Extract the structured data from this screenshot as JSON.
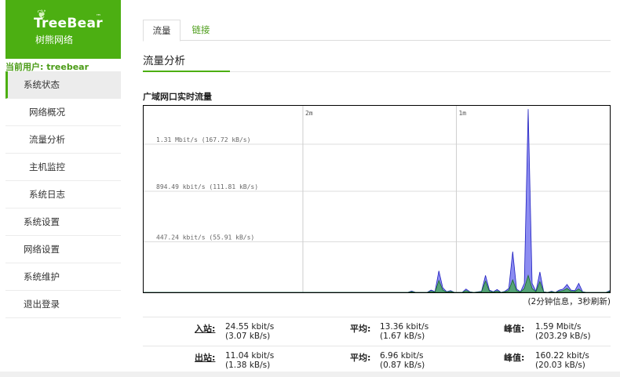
{
  "brand": {
    "name": "TreeBear",
    "tm": "™",
    "subtitle": "树熊网络"
  },
  "user": {
    "current_label": "当前用户: treebear"
  },
  "menu": [
    {
      "label": "系统状态",
      "level": 0,
      "active": true
    },
    {
      "label": "网络概况",
      "level": 1
    },
    {
      "label": "流量分析",
      "level": 1
    },
    {
      "label": "主机监控",
      "level": 1
    },
    {
      "label": "系统日志",
      "level": 1
    },
    {
      "label": "系统设置",
      "level": 0
    },
    {
      "label": "网络设置",
      "level": 0
    },
    {
      "label": "系统维护",
      "level": 0
    },
    {
      "label": "退出登录",
      "level": 0
    }
  ],
  "tabs": [
    {
      "label": "流量",
      "active": true
    },
    {
      "label": "链接",
      "active": false
    }
  ],
  "section": {
    "title": "流量分析"
  },
  "chart_title": "广域网口实时流量",
  "chart_note": "(2分钟信息，3秒刷新)",
  "colors": {
    "brand_green": "#4caf12",
    "inbound_fill": "#8080f0",
    "inbound_stroke": "#2020c0",
    "outbound_fill": "#4fa56a",
    "outbound_stroke": "#1a6b2a"
  },
  "chart_data": {
    "type": "area",
    "x_ticks": [
      "2m",
      "1m"
    ],
    "y_ticks": [
      "447.24 kbit/s (55.91 kB/s)",
      "894.49 kbit/s (111.81 kB/s)",
      "1.31 Mbit/s (167.72 kB/s)"
    ],
    "y_tick_values": [
      447.24,
      894.49,
      1310
    ],
    "ylim": [
      0,
      1650
    ],
    "y_unit": "kbit/s",
    "xlim": [
      -120,
      0
    ],
    "series": [
      {
        "points": [
          [
            -120,
            0
          ],
          [
            -52,
            0
          ],
          [
            -51,
            12
          ],
          [
            -50,
            0
          ],
          [
            -47,
            0
          ],
          [
            -46,
            20
          ],
          [
            -45,
            6
          ],
          [
            -44,
            190
          ],
          [
            -43,
            40
          ],
          [
            -42,
            6
          ],
          [
            -41,
            15
          ],
          [
            -40,
            0
          ],
          [
            -38,
            0
          ],
          [
            -37,
            30
          ],
          [
            -36,
            5
          ],
          [
            -35,
            0
          ],
          [
            -33,
            10
          ],
          [
            -32,
            150
          ],
          [
            -31,
            20
          ],
          [
            -30,
            5
          ],
          [
            -29,
            25
          ],
          [
            -28,
            0
          ],
          [
            -27,
            10
          ],
          [
            -26,
            35
          ],
          [
            -25,
            360
          ],
          [
            -24,
            30
          ],
          [
            -23,
            5
          ],
          [
            -22,
            80
          ],
          [
            -21,
            1620
          ],
          [
            -20,
            80
          ],
          [
            -19,
            10
          ],
          [
            -18,
            180
          ],
          [
            -17,
            5
          ],
          [
            -16,
            0
          ],
          [
            -15,
            10
          ],
          [
            -14,
            0
          ],
          [
            -13,
            20
          ],
          [
            -12,
            30
          ],
          [
            -11,
            70
          ],
          [
            -10,
            20
          ],
          [
            -9,
            15
          ],
          [
            -8,
            80
          ],
          [
            -7,
            5
          ],
          [
            -6,
            0
          ],
          [
            -1,
            0
          ],
          [
            0,
            15
          ]
        ]
      },
      {
        "points": [
          [
            -120,
            0
          ],
          [
            -52,
            0
          ],
          [
            -51,
            6
          ],
          [
            -50,
            0
          ],
          [
            -47,
            0
          ],
          [
            -46,
            10
          ],
          [
            -45,
            3
          ],
          [
            -44,
            105
          ],
          [
            -43,
            20
          ],
          [
            -42,
            3
          ],
          [
            -41,
            8
          ],
          [
            -40,
            0
          ],
          [
            -38,
            0
          ],
          [
            -37,
            15
          ],
          [
            -36,
            3
          ],
          [
            -35,
            0
          ],
          [
            -33,
            5
          ],
          [
            -32,
            100
          ],
          [
            -31,
            10
          ],
          [
            -30,
            3
          ],
          [
            -29,
            12
          ],
          [
            -28,
            0
          ],
          [
            -27,
            5
          ],
          [
            -26,
            15
          ],
          [
            -25,
            110
          ],
          [
            -24,
            15
          ],
          [
            -23,
            3
          ],
          [
            -22,
            35
          ],
          [
            -21,
            150
          ],
          [
            -20,
            35
          ],
          [
            -19,
            5
          ],
          [
            -18,
            95
          ],
          [
            -17,
            3
          ],
          [
            -16,
            0
          ],
          [
            -15,
            5
          ],
          [
            -14,
            0
          ],
          [
            -13,
            10
          ],
          [
            -12,
            15
          ],
          [
            -11,
            35
          ],
          [
            -10,
            10
          ],
          [
            -9,
            8
          ],
          [
            -8,
            30
          ],
          [
            -7,
            3
          ],
          [
            -6,
            0
          ],
          [
            -1,
            0
          ],
          [
            0,
            8
          ]
        ]
      }
    ]
  },
  "stats": {
    "in": {
      "label": "入站:",
      "current": "24.55 kbit/s",
      "current_b": "(3.07 kB/s)",
      "avg_label": "平均:",
      "avg": "13.36 kbit/s",
      "avg_b": "(1.67 kB/s)",
      "peak_label": "峰值:",
      "peak": "1.59 Mbit/s",
      "peak_b": "(203.29 kB/s)"
    },
    "out": {
      "label": "出站:",
      "current": "11.04 kbit/s",
      "current_b": "(1.38 kB/s)",
      "avg_label": "平均:",
      "avg": "6.96 kbit/s",
      "avg_b": "(0.87 kB/s)",
      "peak_label": "峰值:",
      "peak": "160.22 kbit/s",
      "peak_b": "(20.03 kB/s)"
    }
  }
}
